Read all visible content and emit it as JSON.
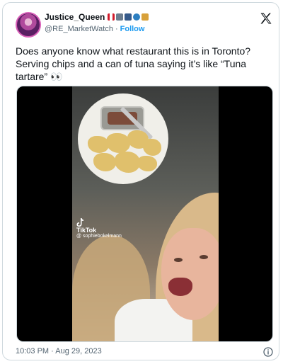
{
  "tweet": {
    "display_name": "Justice_Queen",
    "handle": "@RE_MarketWatch",
    "separator": "·",
    "follow_label": "Follow",
    "text": "Does anyone know what restaurant this is in Toronto?\nServing chips and a can of tuna saying it’s like “Tuna\ntartare” 👀",
    "timestamp": "10:03 PM · Aug 29, 2023"
  },
  "media": {
    "watermark_brand": "TikTok",
    "watermark_user": "@ sophiebokelmann"
  },
  "icons": {
    "brand": "x-logo-icon",
    "info": "info-icon",
    "avatar": "avatar"
  },
  "colors": {
    "link": "#1d9bf0",
    "text": "#0f1419",
    "secondary": "#536471",
    "border": "#cfd9de"
  }
}
